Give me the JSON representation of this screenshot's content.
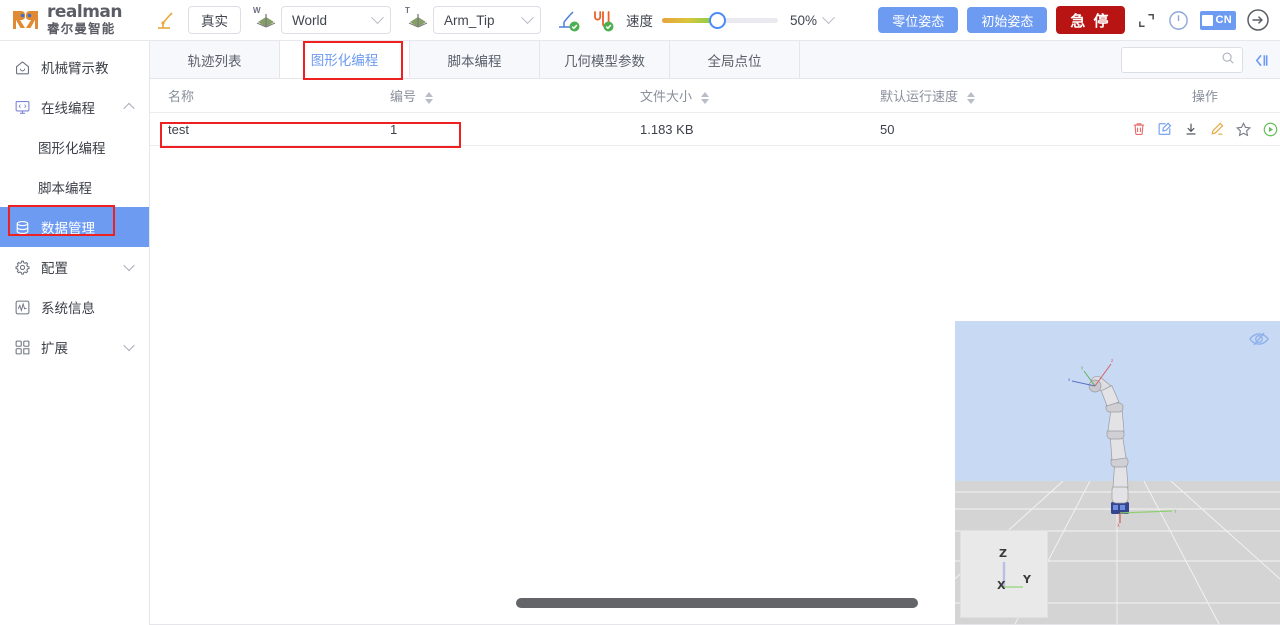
{
  "topbar": {
    "logo_en": "realman",
    "logo_cn": "睿尔曼智能",
    "robot_mode": "真实",
    "frame_icon_label": "W",
    "frame_value": "World",
    "tool_icon_label": "T",
    "tool_value": "Arm_Tip",
    "speed_label": "速度",
    "speed_percent": "50%",
    "speed_value": 50,
    "zero_pose_button": "零位姿态",
    "init_pose_button": "初始姿态",
    "estop_button": "急 停",
    "lang": "CN",
    "icons": {
      "robot_teach": "robot-arm-icon",
      "frame_axes": "world-axes-icon",
      "tool_axes": "tool-axes-icon",
      "arm_status": "arm-connected-icon",
      "gripper_status": "gripper-connected-icon",
      "fullscreen": "fullscreen-icon",
      "power": "power-icon",
      "logout": "logout-icon"
    }
  },
  "sidebar": {
    "items": [
      {
        "label": "机械臂示教",
        "icon": "home-icon",
        "level": "top",
        "chevron": "",
        "active": false
      },
      {
        "label": "在线编程",
        "icon": "code-monitor-icon",
        "level": "top",
        "chevron": "up",
        "active": false
      },
      {
        "label": "图形化编程",
        "icon": "",
        "level": "sub",
        "chevron": "",
        "active": false
      },
      {
        "label": "脚本编程",
        "icon": "",
        "level": "sub",
        "chevron": "",
        "active": false
      },
      {
        "label": "数据管理",
        "icon": "database-icon",
        "level": "top",
        "chevron": "",
        "active": true
      },
      {
        "label": "配置",
        "icon": "gear-icon",
        "level": "top",
        "chevron": "down",
        "active": false
      },
      {
        "label": "系统信息",
        "icon": "waveform-icon",
        "level": "top",
        "chevron": "",
        "active": false
      },
      {
        "label": "扩展",
        "icon": "grid-blocks-icon",
        "level": "top",
        "chevron": "down",
        "active": false
      }
    ]
  },
  "tabs": {
    "items": [
      {
        "label": "轨迹列表",
        "active": false
      },
      {
        "label": "图形化编程",
        "active": true
      },
      {
        "label": "脚本编程",
        "active": false
      },
      {
        "label": "几何模型参数",
        "active": false
      },
      {
        "label": "全局点位",
        "active": false
      }
    ],
    "search_value": "",
    "search_placeholder": "",
    "search_icon": "search-icon",
    "collapse_icon": "collapse-panel-icon"
  },
  "table": {
    "columns": [
      {
        "key": "name",
        "label": "名称",
        "sortable": false
      },
      {
        "key": "num",
        "label": "编号",
        "sortable": true
      },
      {
        "key": "size",
        "label": "文件大小",
        "sortable": true
      },
      {
        "key": "speed",
        "label": "默认运行速度",
        "sortable": true
      },
      {
        "key": "act",
        "label": "操作",
        "sortable": false
      }
    ],
    "rows": [
      {
        "name": "test",
        "num": "1",
        "size": "1.183 KB",
        "speed": "50"
      }
    ],
    "row_actions": [
      {
        "name": "delete-icon",
        "color": "#e86a6a"
      },
      {
        "name": "edit-icon",
        "color": "#6d9bf2"
      },
      {
        "name": "download-icon",
        "color": "#4a4d55"
      },
      {
        "name": "rename-icon",
        "color": "#e8a63d"
      },
      {
        "name": "favorite-icon",
        "color": "#7a7d87"
      },
      {
        "name": "run-icon",
        "color": "#64c05a"
      }
    ]
  },
  "viewport": {
    "eye_icon": "eye-hidden-icon",
    "axis_labels": {
      "z": "Z",
      "x": "X",
      "y": "Y"
    },
    "sky_color": "#c7d9f3",
    "ground_color": "#d4d4d4"
  },
  "highlights": {
    "color": "#ef2020",
    "boxes": [
      "tab-graphical-programming",
      "table-row-test",
      "sidebar-item-data-management"
    ]
  },
  "colors": {
    "accent_blue": "#6d9bf2",
    "danger_red": "#b81414",
    "annotation_red": "#ef2020",
    "logo_orange": "#e08a33"
  }
}
